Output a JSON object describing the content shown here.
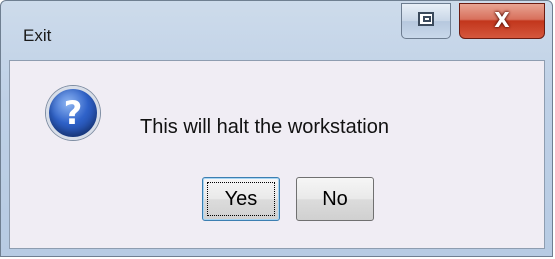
{
  "window": {
    "title": "Exit"
  },
  "titlebar": {
    "restore_icon": "restore-icon",
    "close_label": "X"
  },
  "dialog": {
    "icon": "question-icon",
    "icon_glyph": "?",
    "message": "This will halt the workstation",
    "buttons": {
      "yes_label": "Yes",
      "no_label": "No"
    }
  }
}
